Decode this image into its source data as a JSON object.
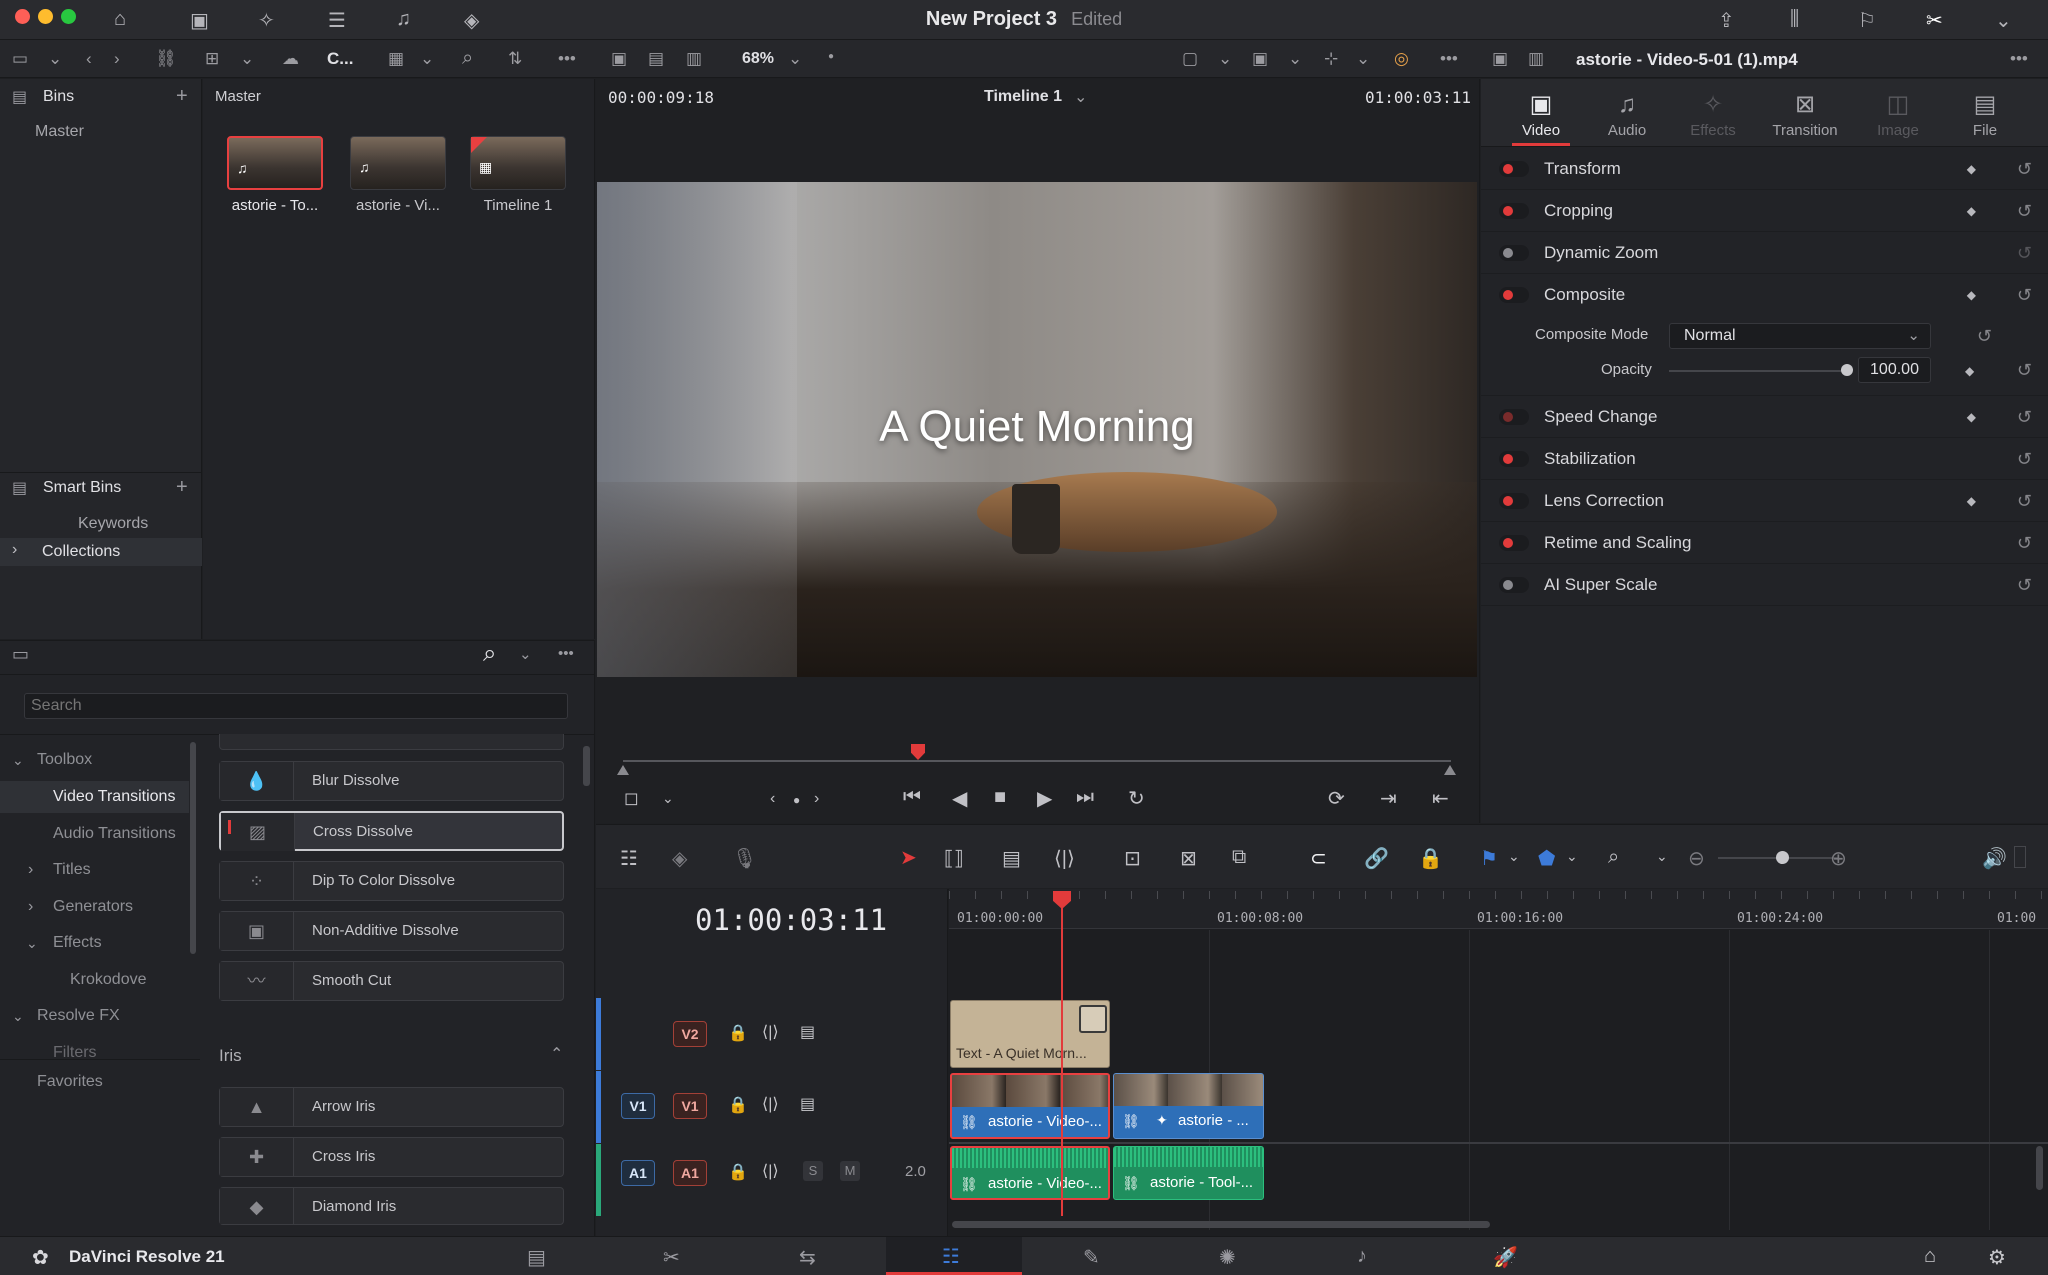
{
  "window": {
    "title": "New Project 3",
    "status": "Edited"
  },
  "media_pool": {
    "bins_label": "Bins",
    "master": "Master",
    "breadcrumb": "Master",
    "smart_bins_label": "Smart Bins",
    "keywords": "Keywords",
    "collections": "Collections",
    "clips": [
      {
        "name": "astorie - To..."
      },
      {
        "name": "astorie - Vi..."
      },
      {
        "name": "Timeline 1"
      }
    ]
  },
  "toolbar": {
    "collapsed_label": "C...",
    "zoom": "68%"
  },
  "viewer": {
    "source_tc": "00:00:09:18",
    "timeline_name": "Timeline 1",
    "record_tc": "01:00:03:11",
    "title_overlay": "A Quiet Morning"
  },
  "effects": {
    "search_placeholder": "Search",
    "tree": [
      {
        "label": "Toolbox"
      },
      {
        "label": "Video Transitions"
      },
      {
        "label": "Audio Transitions"
      },
      {
        "label": "Titles"
      },
      {
        "label": "Generators"
      },
      {
        "label": "Effects"
      },
      {
        "label": "Krokodove"
      },
      {
        "label": "Resolve FX"
      },
      {
        "label": "Filters"
      },
      {
        "label": "Favorites"
      }
    ],
    "dissolve": [
      "Blur Dissolve",
      "Cross Dissolve",
      "Dip To Color Dissolve",
      "Non-Additive Dissolve",
      "Smooth Cut"
    ],
    "iris_header": "Iris",
    "iris": [
      "Arrow Iris",
      "Cross Iris",
      "Diamond Iris"
    ]
  },
  "inspector": {
    "clip_name": "astorie - Video-5-01 (1).mp4",
    "tabs": [
      "Video",
      "Audio",
      "Effects",
      "Transition",
      "Image",
      "File"
    ],
    "rows": [
      "Transform",
      "Cropping",
      "Dynamic Zoom",
      "Composite",
      "Speed Change",
      "Stabilization",
      "Lens Correction",
      "Retime and Scaling",
      "AI Super Scale"
    ],
    "composite_mode_label": "Composite Mode",
    "composite_mode_value": "Normal",
    "opacity_label": "Opacity",
    "opacity_value": "100.00"
  },
  "timeline": {
    "timecode": "01:00:03:11",
    "ruler": [
      "01:00:00:00",
      "01:00:08:00",
      "01:00:16:00",
      "01:00:24:00",
      "01:00"
    ],
    "tracks": {
      "v2": "V2",
      "v1_src": "V1",
      "v1": "V1",
      "a1_src": "A1",
      "a1": "A1",
      "a1_level": "2.0",
      "solo": "S",
      "mute": "M"
    },
    "clips": {
      "text": "Text - A Quiet Morn...",
      "v1a": "astorie - Video-...",
      "v1b": "astorie - ...",
      "a1a": "astorie - Video-...",
      "a1b": "astorie - Tool-..."
    }
  },
  "app": {
    "name": "DaVinci Resolve 21"
  }
}
